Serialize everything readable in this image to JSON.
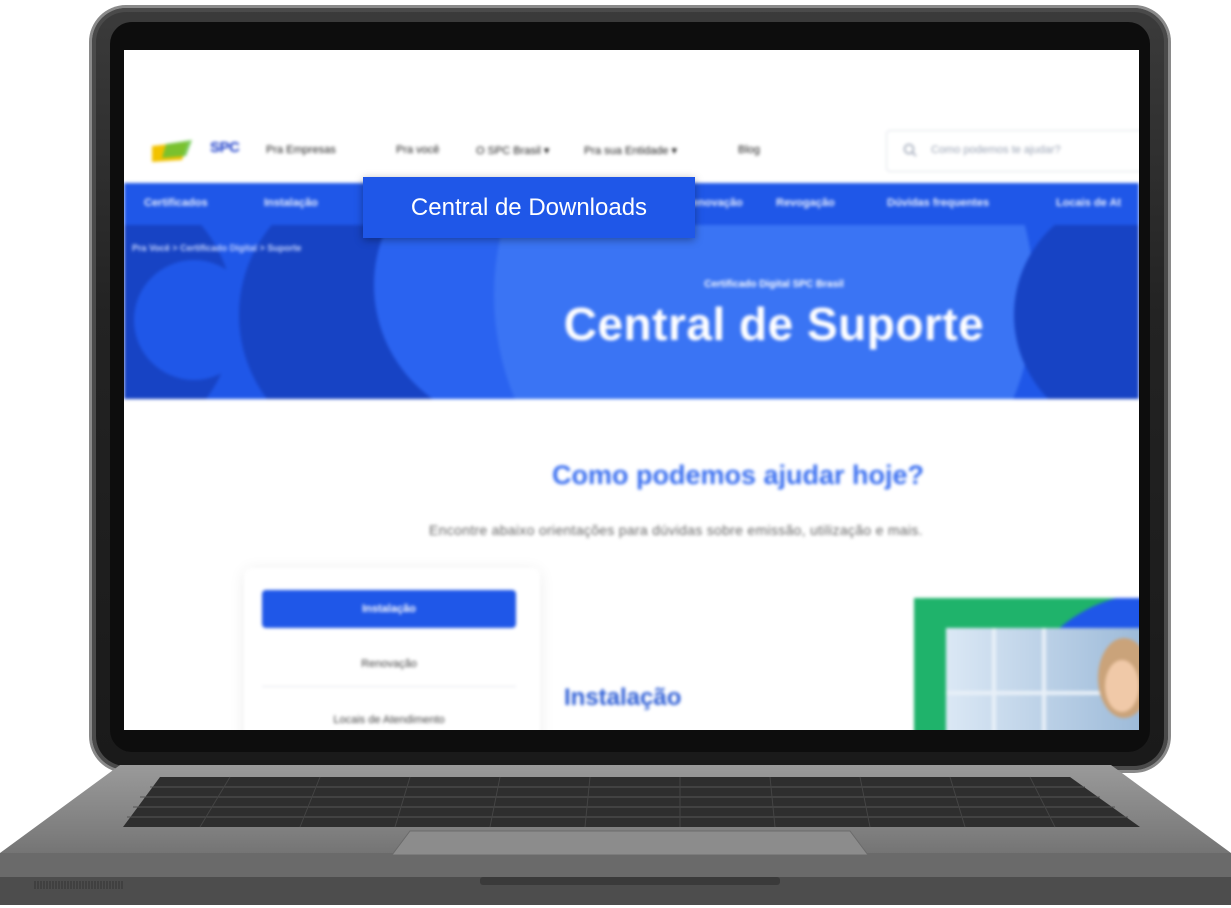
{
  "header": {
    "logo_text": "SPC",
    "nav": [
      "Pra Empresas",
      "Pra você",
      "O SPC Brasil ▾",
      "Pra sua Entidade ▾",
      "Blog"
    ],
    "search_placeholder": "Como podemos te ajudar?"
  },
  "subnav": [
    "Certificados",
    "Instalação",
    "Renovação",
    "Revogação",
    "Dúvidas frequentes",
    "Locais de At"
  ],
  "hero": {
    "breadcrumb": "Pra Você > Certificado Digital > Suporte",
    "kicker": "Certificado Digital SPC Brasil",
    "title": "Central de Suporte"
  },
  "help": {
    "title": "Como podemos ajudar hoje?",
    "subtitle": "Encontre abaixo orientações para dúvidas sobre emissão, utilização e mais."
  },
  "sidebar": {
    "active": "Instalação",
    "items": [
      "Renovação",
      "Locais de Atendimento"
    ]
  },
  "section_title": "Instalação",
  "tooltip": "Central de Downloads",
  "colors": {
    "brand_blue": "#1f57e8",
    "heading_blue": "#3a6ff0",
    "promo_green": "#1fb36b"
  }
}
